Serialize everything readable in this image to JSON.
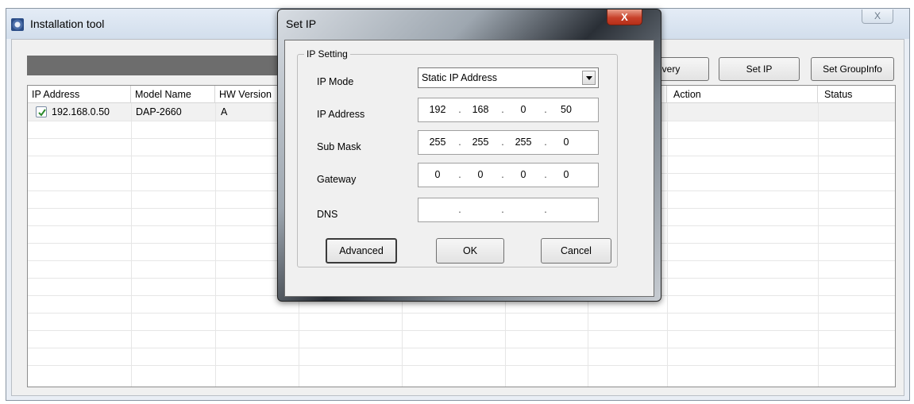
{
  "main_window": {
    "title": "Installation tool",
    "close_glyph": "X",
    "buttons": {
      "discovery_visible": "overy",
      "set_ip": "Set IP",
      "set_group_info": "Set GroupInfo"
    },
    "table": {
      "columns": [
        "IP Address",
        "Model Name",
        "HW Version",
        "Action",
        "Status"
      ],
      "rows": [
        {
          "checked": true,
          "ip_address": "192.168.0.50",
          "model_name": "DAP-2660",
          "hw_version": "A",
          "action": "",
          "status": ""
        }
      ]
    }
  },
  "dialog": {
    "title": "Set IP",
    "close_glyph": "X",
    "group_label": "IP Setting",
    "fields": {
      "ip_mode": {
        "label": "IP Mode",
        "value": "Static IP Address"
      },
      "ip_address": {
        "label": "IP Address",
        "octets": [
          "192",
          "168",
          "0",
          "50"
        ]
      },
      "sub_mask": {
        "label": "Sub Mask",
        "octets": [
          "255",
          "255",
          "255",
          "0"
        ]
      },
      "gateway": {
        "label": "Gateway",
        "octets": [
          "0",
          "0",
          "0",
          "0"
        ]
      },
      "dns": {
        "label": "DNS",
        "octets": [
          "",
          "",
          "",
          ""
        ]
      }
    },
    "buttons": {
      "advanced": "Advanced",
      "ok": "OK",
      "cancel": "Cancel"
    }
  },
  "icons": {
    "app": "installation-tool-icon",
    "checkbox": "checkmark-icon",
    "dropdown": "chevron-down-icon"
  }
}
